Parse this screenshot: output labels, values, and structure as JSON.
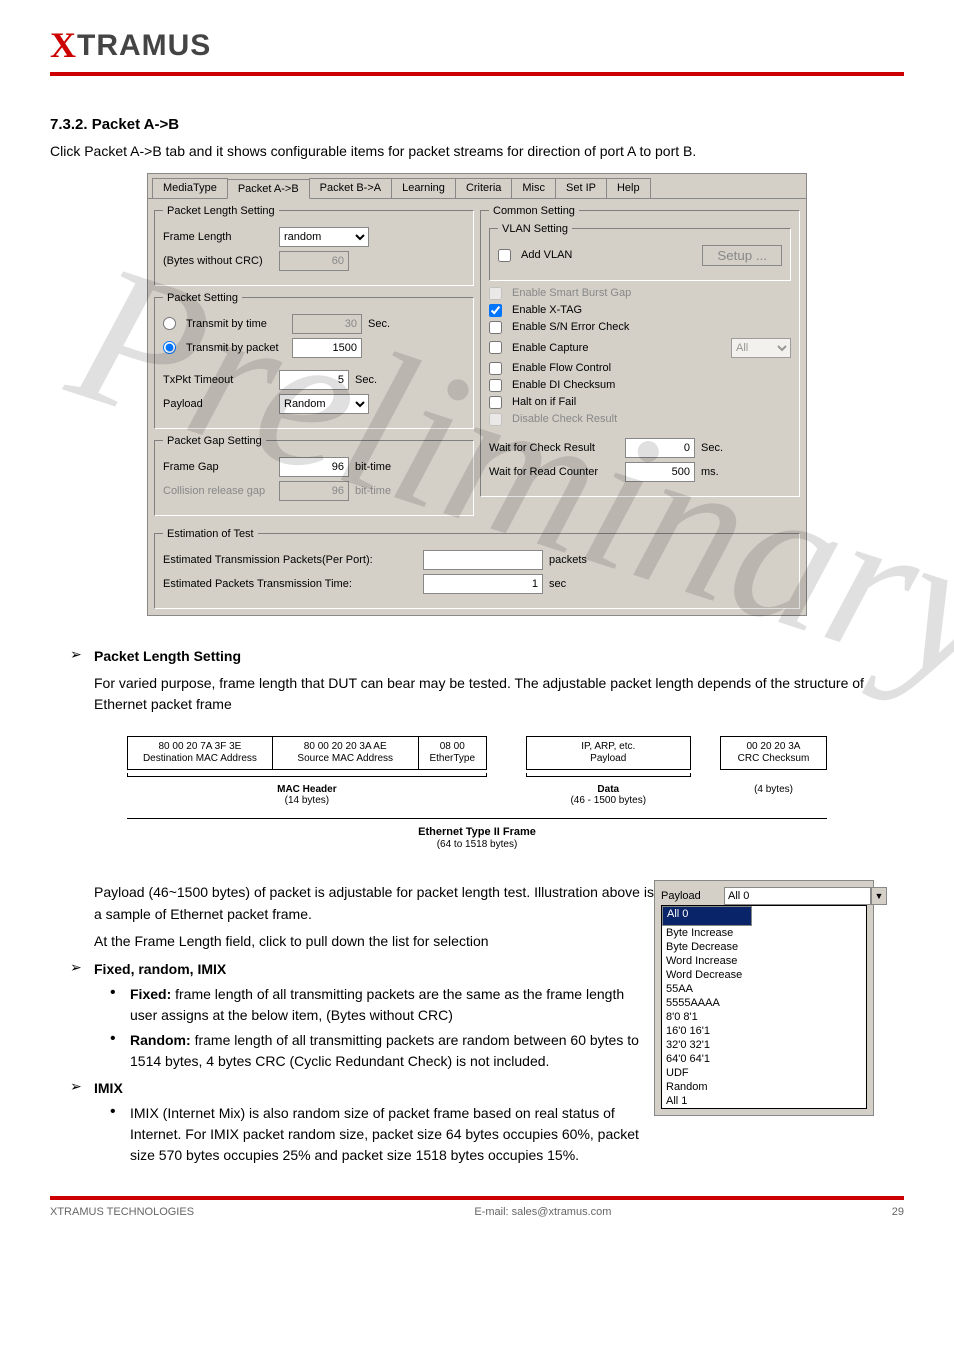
{
  "logo": {
    "x": "X",
    "rest": "TRAMUS"
  },
  "section": {
    "title": "7.3.2. Packet A->B",
    "intro": "Click Packet A->B tab and it shows configurable items for packet streams for direction of port A to port B."
  },
  "tabs": [
    "MediaType",
    "Packet A->B",
    "Packet B->A",
    "Learning",
    "Criteria",
    "Misc",
    "Set IP",
    "Help"
  ],
  "pls": {
    "legend": "Packet Length Setting",
    "frame_length": "Frame Length",
    "frame_length_val": "random",
    "bytes_label": "(Bytes without CRC)",
    "bytes_val": "60"
  },
  "ps": {
    "legend": "Packet Setting",
    "by_time": "Transmit by time",
    "by_time_val": "30",
    "by_time_unit": "Sec.",
    "by_pkt": "Transmit by packet",
    "by_pkt_val": "1500",
    "timeout": "TxPkt Timeout",
    "timeout_val": "5",
    "timeout_unit": "Sec.",
    "payload": "Payload",
    "payload_val": "Random"
  },
  "pg": {
    "legend": "Packet Gap Setting",
    "frame_gap": "Frame Gap",
    "frame_gap_val": "96",
    "frame_gap_unit": "bit-time",
    "col": "Collision release gap",
    "col_val": "96",
    "col_unit": "bit-time"
  },
  "cs": {
    "legend": "Common Setting",
    "vlan_legend": "VLAN Setting",
    "addvlan": "Add VLAN",
    "setup": "Setup ...",
    "smartburst": "Enable Smart Burst Gap",
    "xtag": "Enable X-TAG",
    "snerr": "Enable S/N Error Check",
    "capture": "Enable Capture",
    "capture_opt": "All",
    "flow": "Enable Flow Control",
    "di": "Enable DI Checksum",
    "halt": "Halt on if Fail",
    "discheck": "Disable Check Result",
    "waitcheck": "Wait for Check Result",
    "waitcheck_val": "0",
    "waitcheck_unit": "Sec.",
    "waitread": "Wait for Read Counter",
    "waitread_val": "500",
    "waitread_unit": "ms."
  },
  "est": {
    "legend": "Estimation of Test",
    "l1": "Estimated Transmission Packets(Per Port):",
    "l1_val": "",
    "l1_unit": "packets",
    "l2": "Estimated Packets Transmission Time:",
    "l2_val": "1",
    "l2_unit": "sec"
  },
  "b1": {
    "title": "Packet Length Setting",
    "text": "For varied purpose, frame length that DUT can bear may be tested. The adjustable packet length depends of the structure of Ethernet packet frame"
  },
  "frame": {
    "dmac_hex": "80 00 20 7A 3F 3E",
    "dmac_lab": "Destination MAC Address",
    "smac_hex": "80 00 20 20 3A AE",
    "smac_lab": "Source MAC Address",
    "et_hex": "08 00",
    "et_lab": "EtherType",
    "pl_top": "IP, ARP, etc.",
    "pl_lab": "Payload",
    "crc_hex": "00 20 20 3A",
    "crc_lab": "CRC Checksum",
    "mac_header": "MAC Header",
    "mac_bytes": "(14 bytes)",
    "data_lab": "Data",
    "data_bytes": "(46 - 1500 bytes)",
    "crc_bytes": "(4 bytes)",
    "frame_title": "Ethernet Type II Frame",
    "frame_bytes": "(64 to 1518 bytes)"
  },
  "body2": "Payload (46~1500 bytes) of packet is adjustable for packet length test. Illustration above is a sample of Ethernet packet frame.",
  "body3": "At the Frame Length field, click to pull down the list for selection",
  "b2_title": "Fixed, random, IMIX",
  "sub1": {
    "bold": "Fixed: ",
    "text": "frame length of all transmitting packets are the same as the frame length user assigns at the below item, (Bytes without CRC)"
  },
  "sub2": {
    "bold": "Random: ",
    "text": "frame length of all transmitting packets are random between 60 bytes to 1514 bytes, 4 bytes CRC (Cyclic Redundant Check) is not included."
  },
  "b3_title": "IMIX",
  "sub3": {
    "text": "IMIX (Internet Mix) is also random size of packet frame based on real status of Internet. For IMIX packet random size, packet size 64 bytes occupies 60%, packet size 570 bytes occupies 25% and packet size 1518 bytes occupies 15%."
  },
  "payload_dd": {
    "label": "Payload",
    "value": "All 0",
    "options": [
      "All 0",
      "Byte Increase",
      "Byte Decrease",
      "Word Increase",
      "Word Decrease",
      "55AA",
      "5555AAAA",
      "8'0 8'1",
      "16'0 16'1",
      "32'0 32'1",
      "64'0 64'1",
      "UDF",
      "Random",
      "All 1"
    ]
  },
  "footer": {
    "left": "XTRAMUS TECHNOLOGIES",
    "center": "E-mail: sales@xtramus.com",
    "right": "29"
  }
}
